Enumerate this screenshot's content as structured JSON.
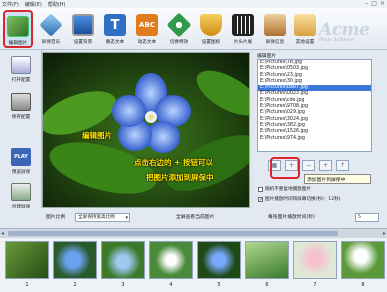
{
  "menu": [
    "文件(F)",
    "编辑(E)",
    "帮助(H)"
  ],
  "toolbar": {
    "items": [
      {
        "label": "编辑图片",
        "color": "#3a8a3a"
      },
      {
        "label": "屏保音乐",
        "color": "#3470b8"
      },
      {
        "label": "设置背景",
        "color": "#2c64b0"
      },
      {
        "label": "静态文本",
        "color": "#2f6fc4"
      },
      {
        "label": "动态文本",
        "color": "#e07c20"
      },
      {
        "label": "切换特效",
        "color": "#2f9a4a"
      },
      {
        "label": "设置图标",
        "color": "#e0a020"
      },
      {
        "label": "片头片尾",
        "color": "#404040"
      },
      {
        "label": "屏保信息",
        "color": "#c07a30"
      },
      {
        "label": "其他设置",
        "color": "#d8a040"
      }
    ],
    "logo": "Acme",
    "logo_sub": "Photo Software"
  },
  "left": [
    {
      "label": "打开配置"
    },
    {
      "label": "保存配置"
    },
    {
      "label": "预览屏保"
    },
    {
      "label": "创建屏保"
    }
  ],
  "annotations": {
    "edit": "编辑图片",
    "hint1": "点击右边的 + 按钮可以",
    "hint2": "把图片添加到屏保中"
  },
  "right": {
    "title": "编辑图片",
    "files": [
      "E:\\Pictures\\7b.jpg",
      "E:\\Pictures\\0503.jpg",
      "E:\\Pictures\\23.jpg",
      "E:\\Pictures\\30.jpg",
      "E:\\Pictures\\bab7.jpg",
      "E:\\Pictures\\0023.jpg",
      "E:\\Pictures\\cde.jpg",
      "E:\\Pictures\\9708.jpg",
      "E:\\Pictures\\029.jpg",
      "E:\\Pictures\\3024.jpg",
      "E:\\Pictures\\382.jpg",
      "E:\\Pictures\\1526.jpg",
      "E:\\Pictures\\974.jpg"
    ],
    "selected_index": 4,
    "tooltip": "添加图片到屏保中",
    "opt1": "随机不重复地播放图片",
    "opt2": "图片播放时间和屏幕切换(秒)：12秒)",
    "opt3": "每张图片播放时间(秒)"
  },
  "under": {
    "ratio_label": "图片比例",
    "ratio_value": "全屏保持宽高比例",
    "mid_label": "全屏查看当前图片",
    "time_value": "5"
  },
  "thumbs": [
    "1",
    "2",
    "3",
    "4",
    "5",
    "6",
    "7",
    "8"
  ],
  "colors": {
    "accent_red": "#d8262a",
    "annotation": "#ffe400",
    "select": "#3c78d8"
  }
}
